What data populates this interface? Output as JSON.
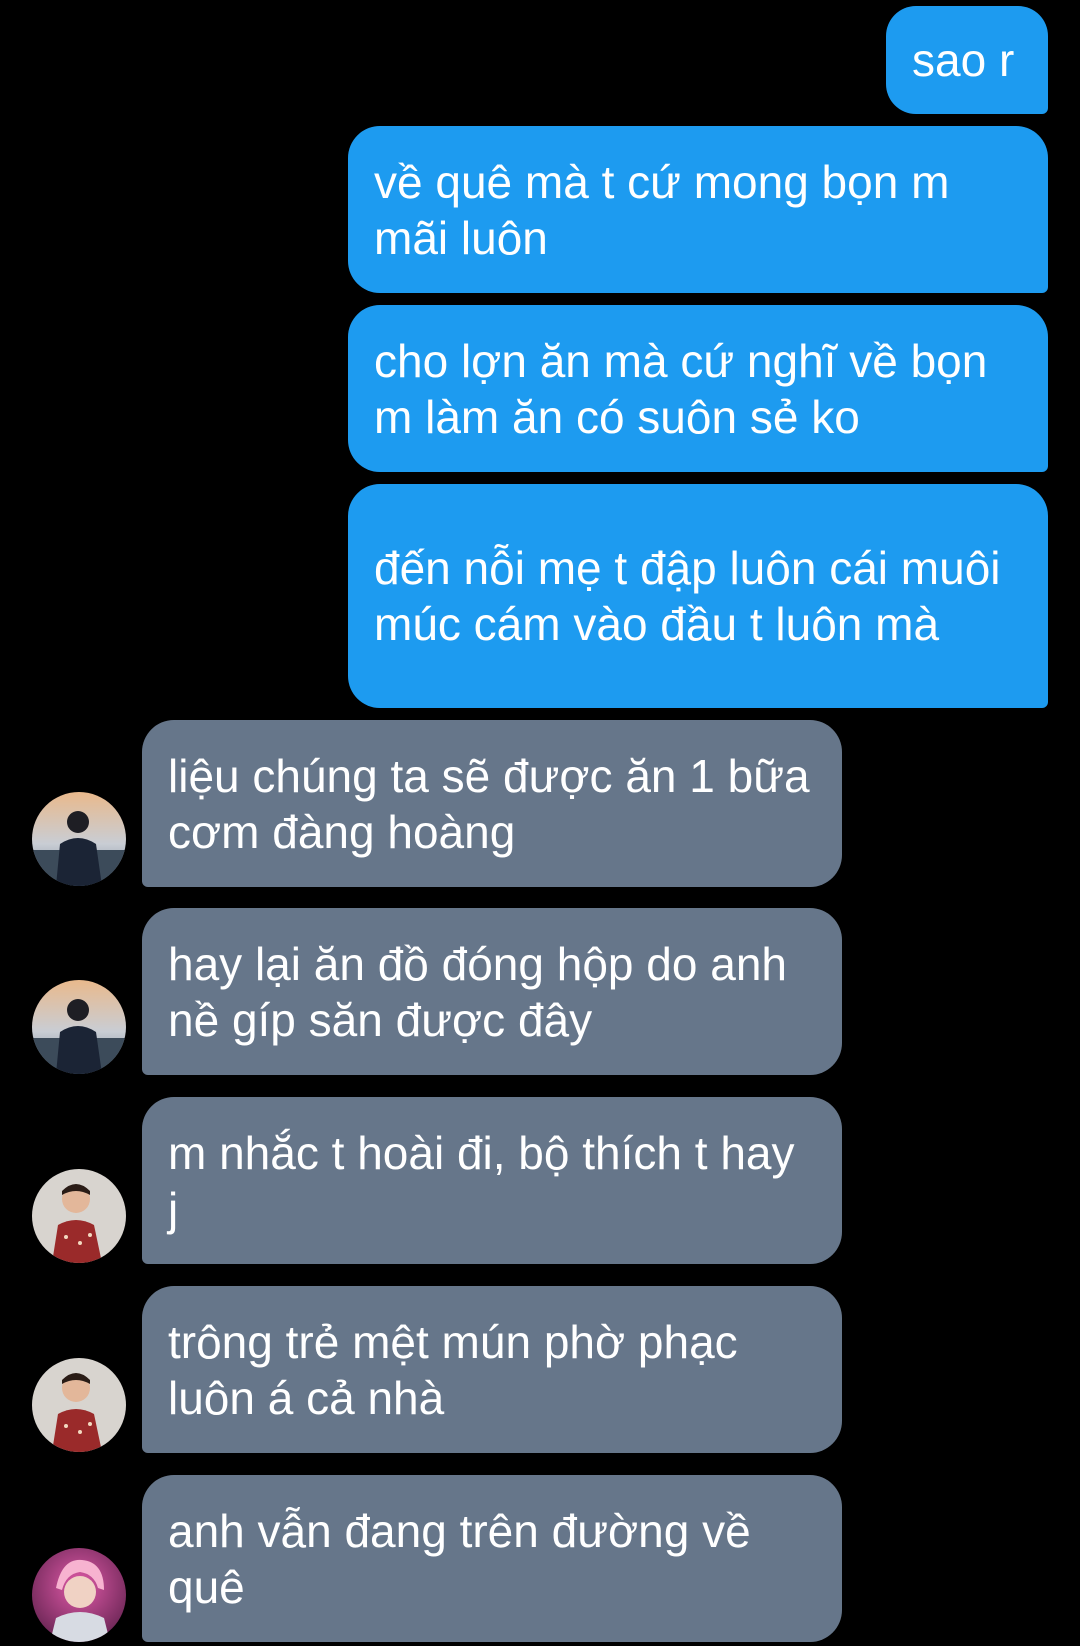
{
  "colors": {
    "background": "#000000",
    "outgoing_bubble": "#1d9bf0",
    "incoming_bubble": "#66768a",
    "text": "#ffffff"
  },
  "messages": [
    {
      "direction": "outgoing",
      "text": "sao r"
    },
    {
      "direction": "outgoing",
      "text": "về quê mà t cứ mong bọn m mãi luôn"
    },
    {
      "direction": "outgoing",
      "text": "cho lợn ăn mà cứ nghĩ về bọn m làm ăn có suôn sẻ ko"
    },
    {
      "direction": "outgoing",
      "text": "đến nỗi mẹ t đập luôn cái muôi múc cám vào đầu t luôn mà"
    },
    {
      "direction": "incoming",
      "avatar": "sunset-person-avatar",
      "text": "liệu chúng ta sẽ được ăn 1 bữa cơm đàng hoàng"
    },
    {
      "direction": "incoming",
      "avatar": "sunset-person-avatar",
      "text": "hay lại ăn đồ đóng hộp do anh nề gíp săn được đây"
    },
    {
      "direction": "incoming",
      "avatar": "red-dress-avatar",
      "text": "m nhắc t hoài đi, bộ thích t hay j"
    },
    {
      "direction": "incoming",
      "avatar": "red-dress-avatar",
      "text": "trông trẻ mệt mún phờ phạc luôn á cả nhà"
    },
    {
      "direction": "incoming",
      "avatar": "pink-hair-avatar",
      "text": "anh vẫn đang trên đường về quê"
    }
  ]
}
